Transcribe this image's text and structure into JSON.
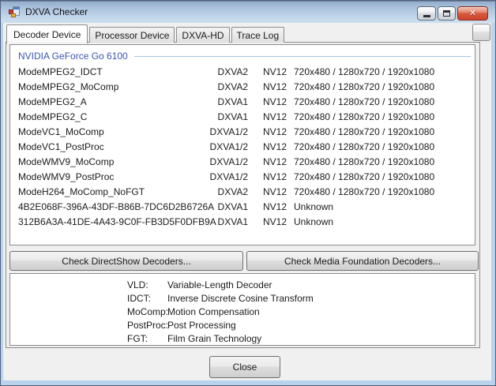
{
  "window": {
    "title": "DXVA Checker",
    "close_glyph": "✕"
  },
  "tabs": [
    {
      "id": "decoder-device",
      "label": "Decoder Device",
      "active": true
    },
    {
      "id": "processor-device",
      "label": "Processor Device",
      "active": false
    },
    {
      "id": "dxva-hd",
      "label": "DXVA-HD",
      "active": false
    },
    {
      "id": "trace-log",
      "label": "Trace Log",
      "active": false
    }
  ],
  "device": {
    "name": "NVIDIA GeForce Go 6100"
  },
  "decoder_table": {
    "rows": [
      {
        "name": "ModeMPEG2_IDCT",
        "api": "DXVA2",
        "format": "NV12",
        "resolutions": "720x480 / 1280x720 / 1920x1080"
      },
      {
        "name": "ModeMPEG2_MoComp",
        "api": "DXVA2",
        "format": "NV12",
        "resolutions": "720x480 / 1280x720 / 1920x1080"
      },
      {
        "name": "ModeMPEG2_A",
        "api": "DXVA1",
        "format": "NV12",
        "resolutions": "720x480 / 1280x720 / 1920x1080"
      },
      {
        "name": "ModeMPEG2_C",
        "api": "DXVA1",
        "format": "NV12",
        "resolutions": "720x480 / 1280x720 / 1920x1080"
      },
      {
        "name": "ModeVC1_MoComp",
        "api": "DXVA1/2",
        "format": "NV12",
        "resolutions": "720x480 / 1280x720 / 1920x1080"
      },
      {
        "name": "ModeVC1_PostProc",
        "api": "DXVA1/2",
        "format": "NV12",
        "resolutions": "720x480 / 1280x720 / 1920x1080"
      },
      {
        "name": "ModeWMV9_MoComp",
        "api": "DXVA1/2",
        "format": "NV12",
        "resolutions": "720x480 / 1280x720 / 1920x1080"
      },
      {
        "name": "ModeWMV9_PostProc",
        "api": "DXVA1/2",
        "format": "NV12",
        "resolutions": "720x480 / 1280x720 / 1920x1080"
      },
      {
        "name": "ModeH264_MoComp_NoFGT",
        "api": "DXVA2",
        "format": "NV12",
        "resolutions": "720x480 / 1280x720 / 1920x1080"
      },
      {
        "name": "4B2E068F-396A-43DF-B86B-7DC6D2B6726A",
        "api": "DXVA1",
        "format": "NV12",
        "resolutions": "Unknown"
      },
      {
        "name": "312B6A3A-41DE-4A43-9C0F-FB3D5F0DFB9A",
        "api": "DXVA1",
        "format": "NV12",
        "resolutions": "Unknown"
      }
    ]
  },
  "actions": {
    "check_directshow": "Check DirectShow Decoders...",
    "check_media_foundation": "Check Media Foundation Decoders..."
  },
  "legend": {
    "entries": [
      {
        "term": "VLD:",
        "definition": "Variable-Length Decoder"
      },
      {
        "term": "IDCT:",
        "definition": "Inverse Discrete Cosine Transform"
      },
      {
        "term": "MoComp:",
        "definition": "Motion Compensation"
      },
      {
        "term": "PostProc:",
        "definition": "Post Processing"
      },
      {
        "term": "FGT:",
        "definition": "Film Grain Technology"
      }
    ]
  },
  "footer": {
    "close_label": "Close"
  },
  "colors": {
    "device_header_text": "#3a56b4",
    "group_line": "#a9c3e4",
    "titlebar_top": "#8fa9c7",
    "titlebar_bottom": "#cddff0",
    "window_border": "#b9d3ec",
    "close_button": "#cc4431",
    "client_bg": "#f0f0f0"
  }
}
